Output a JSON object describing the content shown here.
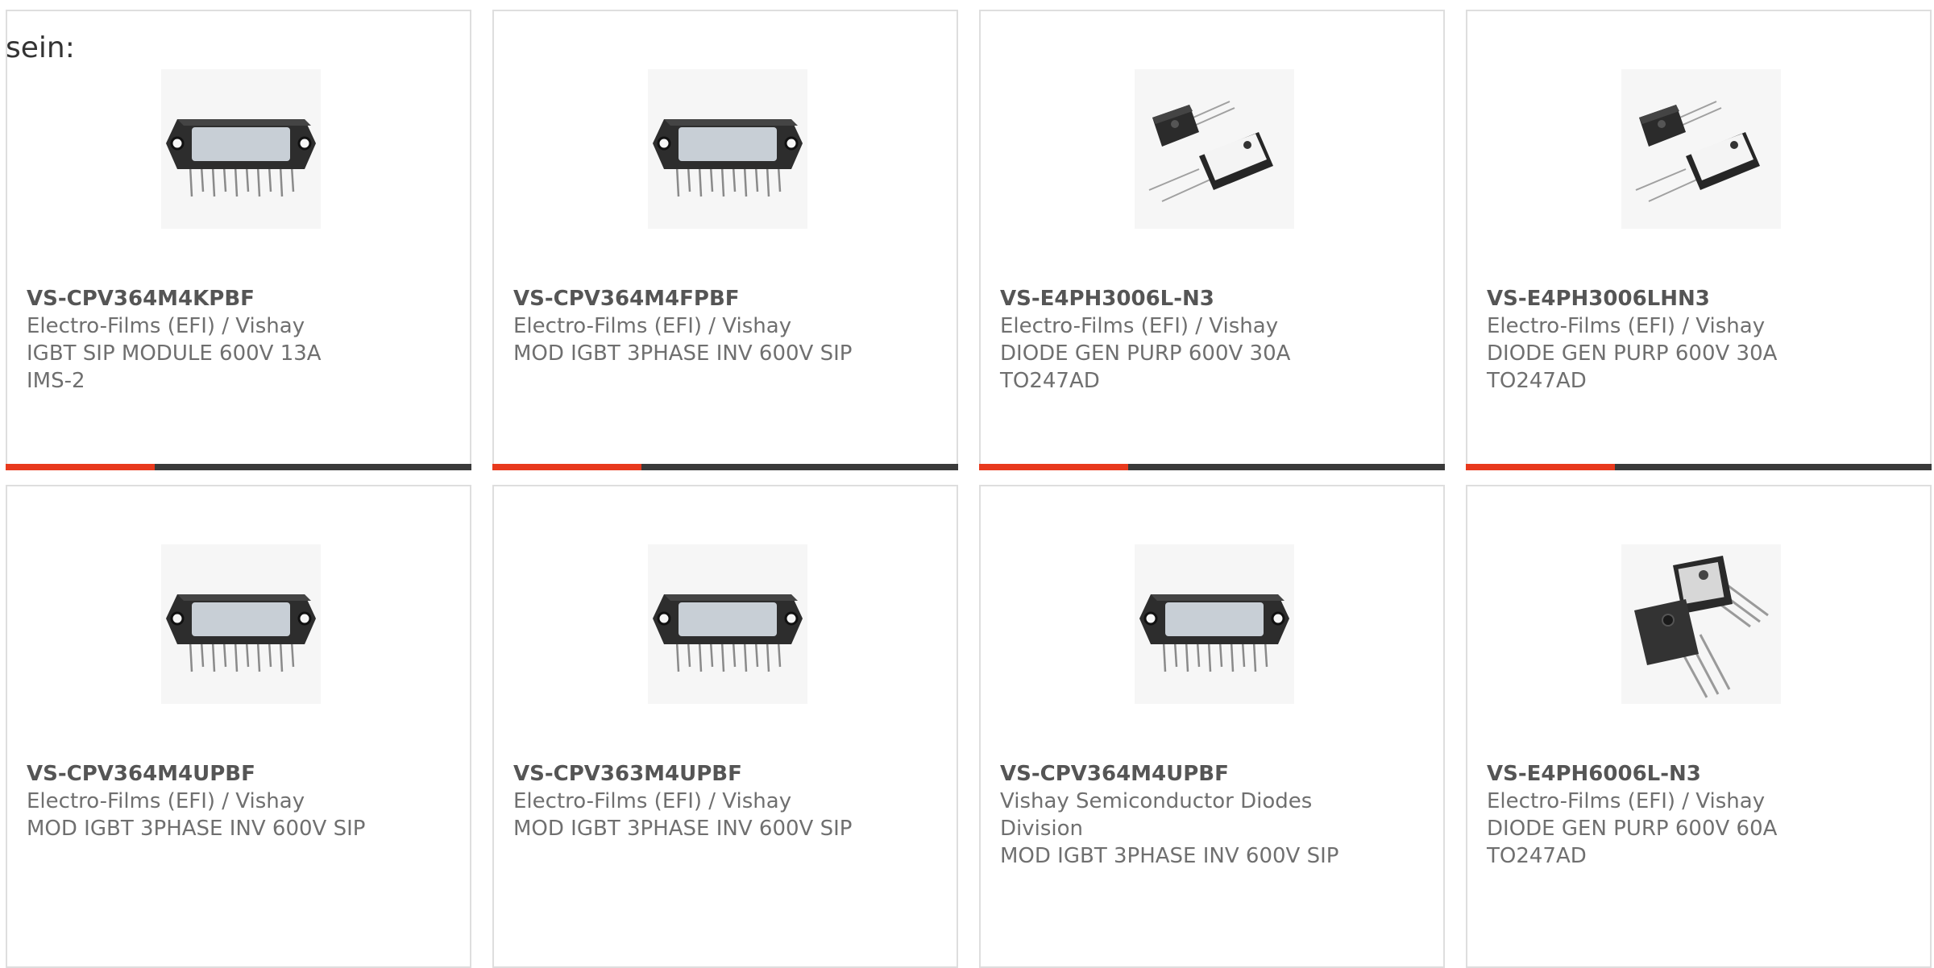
{
  "intro_text": "sein:",
  "accent_color": "#e8391d",
  "bar_color": "#3a3a3a",
  "products": [
    {
      "part_number": "VS-CPV364M4KPBF",
      "manufacturer": "Electro-Films (EFI) / Vishay",
      "description": "IGBT SIP MODULE 600V 13A",
      "description_2": "IMS-2",
      "image": "sip-module-icon"
    },
    {
      "part_number": "VS-CPV364M4FPBF",
      "manufacturer": "Electro-Films (EFI) / Vishay",
      "description": "MOD IGBT 3PHASE INV 600V SIP",
      "description_2": "",
      "image": "sip-module-icon"
    },
    {
      "part_number": "VS-E4PH3006L-N3",
      "manufacturer": "Electro-Films (EFI) / Vishay",
      "description": "DIODE GEN PURP 600V 30A",
      "description_2": "TO247AD",
      "image": "to247-2lead-icon"
    },
    {
      "part_number": "VS-E4PH3006LHN3",
      "manufacturer": "Electro-Films (EFI) / Vishay",
      "description": "DIODE GEN PURP 600V 30A",
      "description_2": "TO247AD",
      "image": "to247-2lead-icon"
    },
    {
      "part_number": "VS-CPV364M4UPBF",
      "manufacturer": "Electro-Films (EFI) / Vishay",
      "description": "MOD IGBT 3PHASE INV 600V SIP",
      "description_2": "",
      "image": "sip-module-icon"
    },
    {
      "part_number": "VS-CPV363M4UPBF",
      "manufacturer": "Electro-Films (EFI) / Vishay",
      "description": "MOD IGBT 3PHASE INV 600V SIP",
      "description_2": "",
      "image": "sip-module-icon"
    },
    {
      "part_number": "VS-CPV364M4UPBF",
      "manufacturer": "Vishay Semiconductor Diodes",
      "manufacturer_2": "Division",
      "description": "MOD IGBT 3PHASE INV 600V SIP",
      "description_2": "",
      "image": "sip-module-icon"
    },
    {
      "part_number": "VS-E4PH6006L-N3",
      "manufacturer": "Electro-Films (EFI) / Vishay",
      "description": "DIODE GEN PURP 600V 60A",
      "description_2": "TO247AD",
      "image": "to247-3lead-icon"
    }
  ]
}
